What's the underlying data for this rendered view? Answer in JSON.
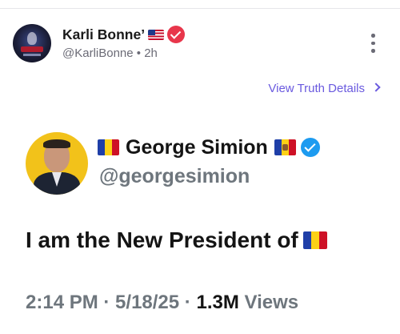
{
  "post": {
    "author_name": "Karli Bonne’",
    "author_flag_icon": "us-flag-icon",
    "handle": "@KarliBonne",
    "separator": "•",
    "time": "2h",
    "details_link": "View Truth Details"
  },
  "embedded_tweet": {
    "name": "George Simion",
    "handle": "@georgesimion",
    "text": "I am the New President of",
    "time": "2:14 PM",
    "date": "5/18/25",
    "dot": "·",
    "views_count": "1.3M",
    "views_label": "Views"
  },
  "colors": {
    "accent_link": "#6a5adf",
    "verified_red": "#e8364b",
    "verified_blue": "#1d9bf0",
    "muted_text": "#6e767d"
  }
}
